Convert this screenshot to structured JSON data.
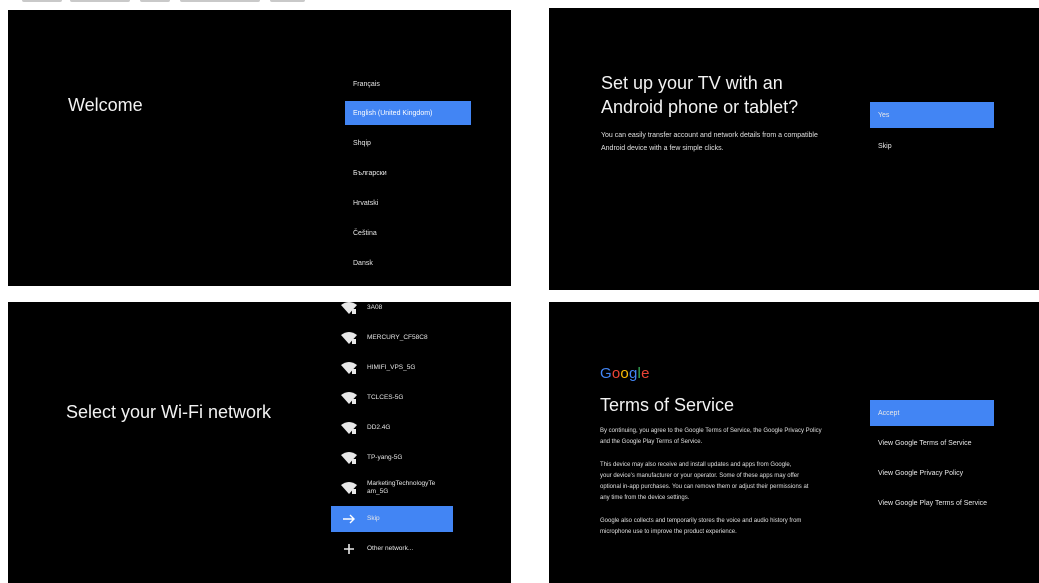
{
  "welcome": {
    "title": "Welcome",
    "languages": [
      {
        "label": "Français",
        "selected": false
      },
      {
        "label": "English (United Kingdom)",
        "selected": true
      },
      {
        "label": "Shqip",
        "selected": false
      },
      {
        "label": "Български",
        "selected": false
      },
      {
        "label": "Hrvatski",
        "selected": false
      },
      {
        "label": "Čeština",
        "selected": false
      },
      {
        "label": "Dansk",
        "selected": false
      }
    ]
  },
  "phone_setup": {
    "title_line1": "Set up your TV with an",
    "title_line2": "Android phone or tablet?",
    "description_line1": "You can easily transfer account and network details from a compatible",
    "description_line2": "Android device with a few simple clicks.",
    "options": [
      {
        "label": "Yes",
        "selected": true
      },
      {
        "label": "Skip",
        "selected": false
      }
    ]
  },
  "wifi": {
    "title": "Select your Wi-Fi network",
    "networks": [
      {
        "name": "3A08",
        "icon": "wifi-icon"
      },
      {
        "name": "MERCURY_CF58C8",
        "icon": "wifi-icon"
      },
      {
        "name": "HIMIFI_VPS_5G",
        "icon": "wifi-icon"
      },
      {
        "name": "TCLCES-5G",
        "icon": "wifi-icon"
      },
      {
        "name": "DD2.4G",
        "icon": "wifi-icon"
      },
      {
        "name": "TP-yang-5G",
        "icon": "wifi-icon"
      },
      {
        "name_line1": "MarketingTechnologyTe",
        "name_line2": "am_5G",
        "icon": "wifi-icon"
      }
    ],
    "skip_label": "Skip",
    "other_label": "Other network..."
  },
  "tos": {
    "logo_letters": [
      "G",
      "o",
      "o",
      "g",
      "l",
      "e"
    ],
    "logo_colors": [
      "#4285f4",
      "#ea4335",
      "#fbbc05",
      "#4285f4",
      "#34a853",
      "#ea4335"
    ],
    "title": "Terms of Service",
    "para1_line1": "By continuing, you agree to the Google Terms of Service, the Google Privacy Policy",
    "para1_line2": "and the Google Play Terms of Service.",
    "para2_line1": "This device may also receive and install updates and apps from Google,",
    "para2_line2": "your device's manufacturer or your operator. Some of these apps may offer",
    "para2_line3": "optional in-app purchases. You can remove them or adjust their permissions at",
    "para2_line4": "any time from the device settings.",
    "para3_line1": "Google also collects and temporarily stores the voice and audio history from",
    "para3_line2": "microphone use to improve the product experience.",
    "options": [
      {
        "label": "Accept",
        "selected": true
      },
      {
        "label": "View Google Terms of Service",
        "selected": false
      },
      {
        "label": "View Google Privacy Policy",
        "selected": false
      },
      {
        "label": "View Google Play Terms of Service",
        "selected": false
      }
    ]
  },
  "colors": {
    "accent": "#4285f4",
    "panel_bg": "#000000",
    "page_bg": "#ffffff"
  }
}
